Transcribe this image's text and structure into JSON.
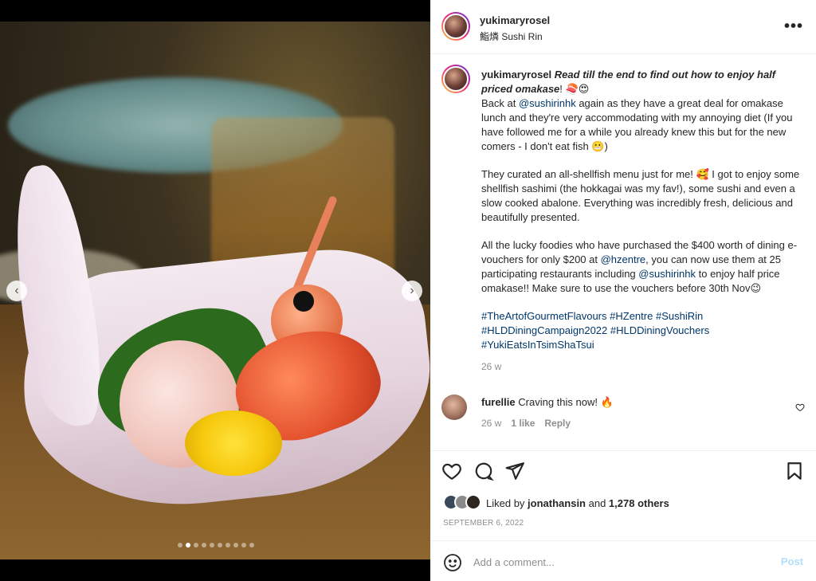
{
  "post": {
    "username": "yukimaryrosel",
    "location": "鮨燐 Sushi Rin",
    "more_icon": "more-horizontal-icon",
    "carousel": {
      "total_slides": 10,
      "current_slide": 2
    }
  },
  "caption": {
    "username": "yukimaryrosel",
    "hook": "Read till the end to find out how to enjoy half priced omakase",
    "hook_end": "! 🍣😍",
    "p1_a": "Back at ",
    "p1_mention": "@sushirinhk",
    "p1_b": " again as they have a great deal for omakase lunch and they're very accommodating with my annoying diet (If you have followed me for a while you already knew this but for the new comers - I don't eat fish 😬)",
    "p2": "They curated an all-shellfish menu just for me! 🥰 I got to enjoy some shellfish sashimi (the hokkagai was my fav!), some sushi and even a slow cooked abalone. Everything was incredibly fresh, delicious and beautifully presented.",
    "p3_a": "All the lucky foodies who have purchased the $400 worth of dining e-vouchers for only $200 at ",
    "p3_mention1": "@hzentre",
    "p3_b": ", you can now use them at 25 participating restaurants including ",
    "p3_mention2": "@sushirinhk",
    "p3_c": " to enjoy half price omakase!! Make sure to use the vouchers before 30th Nov😉",
    "hashtags": [
      "#TheArtofGourmetFlavours",
      "#HZentre",
      "#SushiRin",
      "#HLDDiningCampaign2022",
      "#HLDDiningVouchers",
      "#YukiEatsInTsimShaTsui"
    ],
    "age": "26 w"
  },
  "comment": {
    "username": "furellie",
    "text": "Craving this now! 🔥",
    "age": "26 w",
    "likes": "1 like",
    "reply": "Reply"
  },
  "engagement": {
    "liked_prefix": "Liked by ",
    "liked_user": "jonathansin",
    "liked_mid": " and ",
    "liked_count": "1,278 others",
    "date": "SEPTEMBER 6, 2022"
  },
  "composer": {
    "placeholder": "Add a comment...",
    "post_label": "Post"
  },
  "colors": {
    "link": "#00376b",
    "muted": "#8e8e8e",
    "post_disabled": "#b2dffc"
  }
}
